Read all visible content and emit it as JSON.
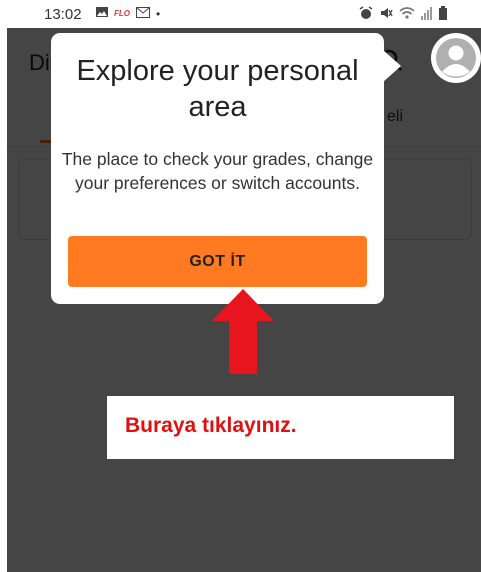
{
  "status_bar": {
    "time": "13:02",
    "left_icons": [
      "image-icon",
      "flo-icon",
      "gmail-icon",
      "dot-icon"
    ],
    "flo_label": "FLO",
    "right_icons": [
      "alarm-icon",
      "mute-icon",
      "wifi-icon",
      "signal-icon",
      "battery-icon"
    ]
  },
  "app": {
    "title_partial": "Di",
    "tab_partial": "eli",
    "accent_color": "#ff7a20"
  },
  "popup": {
    "title": "Explore your personal area",
    "body": "The place to check your grades, change your preferences or switch accounts.",
    "button_label": "GOT İT"
  },
  "annotation": {
    "text": "Buraya tıklayınız.",
    "color": "#e01010"
  }
}
